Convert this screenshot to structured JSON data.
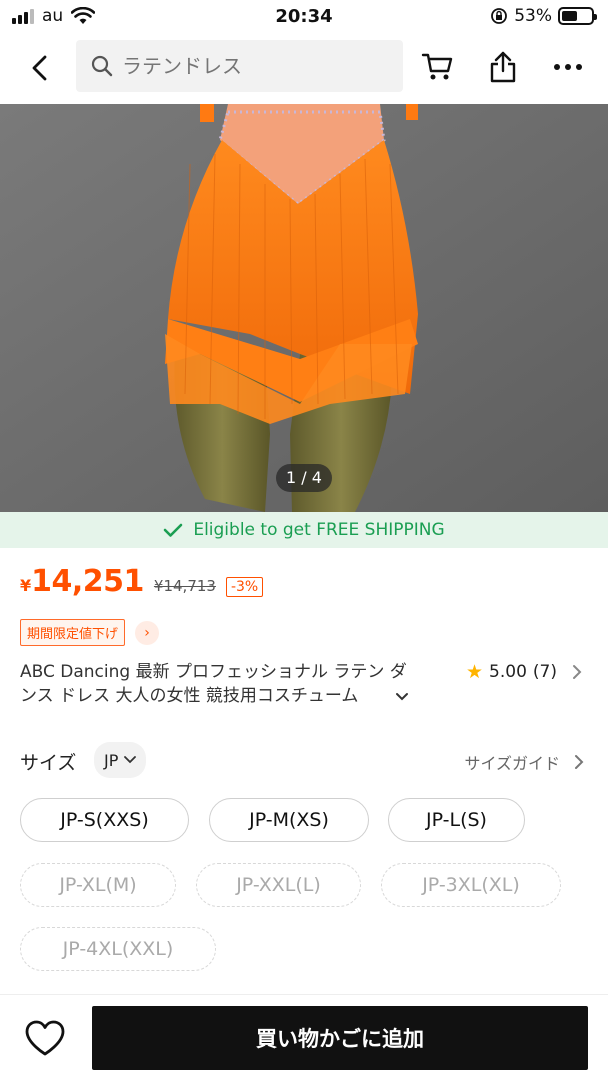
{
  "status_bar": {
    "carrier": "au",
    "time": "20:34",
    "battery_percent": "53%",
    "battery_level": 0.53
  },
  "nav": {
    "search_placeholder": "ラテンドレス",
    "icons": [
      "back-icon",
      "search-icon",
      "cart-icon",
      "share-icon",
      "more-icon"
    ]
  },
  "gallery": {
    "counter": "1 / 4"
  },
  "shipping": {
    "text": "Eligible to get FREE SHIPPING",
    "color": "#1a9e52"
  },
  "pricing": {
    "currency": "¥",
    "price": "14,251",
    "original_price": "¥14,713",
    "discount": "-3%",
    "accent_color": "#ff5000"
  },
  "promo": {
    "badge": "期間限定値下げ",
    "arrow": "›"
  },
  "product": {
    "title": "ABC Dancing 最新 プロフェッショナル ラテン ダンス ドレス 大人の女性 競技用コスチューム",
    "rating": "5.00",
    "review_count": "(7)"
  },
  "size": {
    "label": "サイズ",
    "region": "JP",
    "guide_label": "サイズガイド",
    "options": [
      {
        "label": "JP-S(XXS)",
        "available": true
      },
      {
        "label": "JP-M(XS)",
        "available": true
      },
      {
        "label": "JP-L(S)",
        "available": true
      },
      {
        "label": "JP-XL(M)",
        "available": false
      },
      {
        "label": "JP-XXL(L)",
        "available": false
      },
      {
        "label": "JP-3XL(XL)",
        "available": false
      },
      {
        "label": "JP-4XL(XXL)",
        "available": false
      }
    ]
  },
  "bottom": {
    "add_to_cart": "買い物かごに追加"
  }
}
